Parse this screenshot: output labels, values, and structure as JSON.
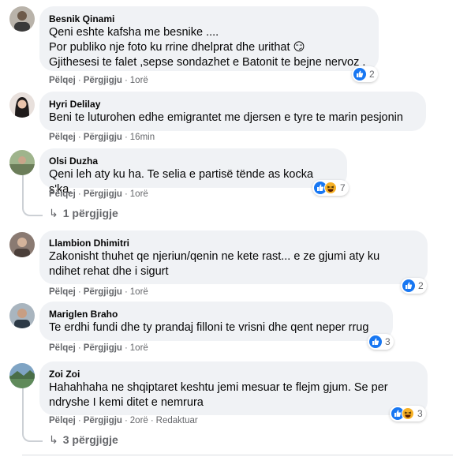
{
  "comments": [
    {
      "author": "Besnik Qinami",
      "text": "Qeni eshte kafsha me besnike ....\nPor publiko nje foto ku rrine dhelprat dhe urithat 😏\nGjithesesi te falet ,sepse sondazhet e Batonit te bejne nervoz .",
      "like_label": "Pëlqej",
      "reply_label": "Përgjigju",
      "time": "1orë",
      "reaction_count": "2"
    },
    {
      "author": "Hyri Delilay",
      "text": "Beni te luturohen edhe emigrantet me djersen e tyre te marin pesjonin",
      "like_label": "Pëlqej",
      "reply_label": "Përgjigju",
      "time": "16min"
    },
    {
      "author": "Olsi Duzha",
      "text": "Qeni leh aty ku ha. Te selia e partisë tënde as kocka s'ka.",
      "like_label": "Pëlqej",
      "reply_label": "Përgjigju",
      "time": "1orë",
      "reaction_count": "7",
      "replies_label": "1 përgjigje"
    },
    {
      "author": "Llambion Dhimitri",
      "text": "Zakonisht thuhet qe njeriun/qenin ne kete rast... e ze gjumi aty ku\nndihet rehat dhe i sigurt",
      "like_label": "Pëlqej",
      "reply_label": "Përgjigju",
      "time": "1orë",
      "reaction_count": "2"
    },
    {
      "author": "Mariglen Braho",
      "text": "Te erdhi fundi dhe ty prandaj filloni te vrisni dhe qent neper rrug",
      "like_label": "Pëlqej",
      "reply_label": "Përgjigju",
      "time": "1orë",
      "reaction_count": "3"
    },
    {
      "author": "Zoi Zoi",
      "text": "Hahahhaha ne shqiptaret keshtu jemi mesuar te flejm gjum. Se per\nndryshe I kemi ditet e nemrura",
      "like_label": "Pëlqej",
      "reply_label": "Përgjigju",
      "time": "2orë",
      "edited": "Redaktuar",
      "reaction_count": "3",
      "replies_label": "3 përgjigje"
    }
  ],
  "icons": {
    "like": "like-icon",
    "haha": "haha-icon",
    "reply_arrow": "reply-arrow-icon"
  },
  "colors": {
    "like": "#1877f2",
    "haha": "#f7b125",
    "bubble": "#f0f2f5",
    "meta": "#65676b"
  }
}
